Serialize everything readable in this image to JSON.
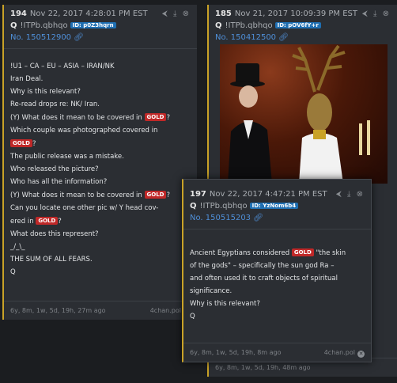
{
  "post194": {
    "num": "194",
    "date": "Nov 22, 2017 4:28:01 PM EST",
    "author": "Q",
    "trip": "!ITPb.qbhqo",
    "id_badge": "ID: p0Z3hqrn",
    "post_no": "No. 150512900",
    "lines": {
      "l1": "!U1 – CA – EU – ASIA – IRAN/NK",
      "l2": "Iran Deal.",
      "l3": "Why is this relevant?",
      "l4": "Re-read drops re: NK/ Iran.",
      "l5a": "(Y) What does it mean to be covered in",
      "l5b": "?",
      "l6": "Which couple was photographed covered in",
      "l7b": "?",
      "l8": "The public release was a mistake.",
      "l9": "Who released the picture?",
      "l10": "Who has all the information?",
      "l11a": "(Y) What does it mean to be covered in",
      "l11b": "?",
      "l12": "Can you locate one other pic w/ Y head cov-",
      "l13a": "ered in",
      "l13b": "?",
      "l14": "What does this represent?",
      "l15": "_/_\\_",
      "l16": "THE SUM OF ALL FEARS.",
      "l17": "Q"
    },
    "gold": "GOLD",
    "age": "6y, 8m, 1w, 5d, 19h, 27m ago",
    "source": "4chan.pol"
  },
  "post185": {
    "num": "185",
    "date": "Nov 21, 2017 10:09:39 PM EST",
    "author": "Q",
    "trip": "!ITPb.qbhqo",
    "id_badge": "ID: pOV6fY+r",
    "post_no": "No. 150412500",
    "age_partial": "6y, 8m, 1w, 5d, 19h, 48m ago"
  },
  "post197": {
    "num": "197",
    "date": "Nov 22, 2017 4:47:21 PM EST",
    "author": "Q",
    "trip": "!ITPb.qbhqo",
    "id_badge": "ID: YzNom6b4",
    "post_no": "No. 150515203",
    "lines": {
      "l1a": "Ancient Egyptians considered",
      "l1b": "\"the skin",
      "l2": "of the gods\" – specifically the sun god Ra –",
      "l3": "and often used it to craft objects of spiritual",
      "l4": "significance.",
      "l5": "Why is this relevant?",
      "l6": "Q"
    },
    "gold": "GOLD",
    "age": "6y, 8m, 1w, 5d, 19h, 8m ago",
    "source": "4chan.pol"
  },
  "icons": {
    "share": "share-icon",
    "download": "download-icon",
    "close": "close-icon",
    "link": "link-icon"
  }
}
